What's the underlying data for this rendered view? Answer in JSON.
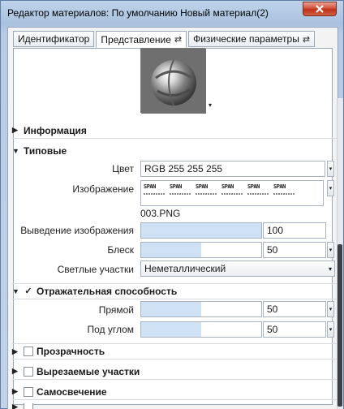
{
  "window": {
    "title": "Редактор материалов: По умолчанию Новый материал(2)"
  },
  "tabs": [
    {
      "label": "Идентификатор",
      "active": false,
      "pinned": false
    },
    {
      "label": "Представление",
      "active": true,
      "pinned": true
    },
    {
      "label": "Физические параметры",
      "active": false,
      "pinned": true
    }
  ],
  "icons": {
    "pin": "⇄",
    "expand": "▶",
    "collapse": "▼",
    "caret": "▾",
    "check": "✓"
  },
  "sections": {
    "info": {
      "label": "Информация",
      "expanded": false
    },
    "generic": {
      "label": "Типовые",
      "expanded": true
    },
    "reflectivity": {
      "label": "Отражательная способность",
      "expanded": true,
      "checked": true
    },
    "transparency": {
      "label": "Прозрачность",
      "expanded": false,
      "checked": false
    },
    "cutouts": {
      "label": "Вырезаемые участки",
      "expanded": false,
      "checked": false
    },
    "self_illumination": {
      "label": "Самосвечение",
      "expanded": false,
      "checked": false
    }
  },
  "generic": {
    "color_label": "Цвет",
    "color_value": "RGB 255 255 255",
    "image_label": "Изображение",
    "image_thumb_text": "SPAN",
    "image_thumb_count": 6,
    "image_name": "003.PNG",
    "image_fade_label": "Выведение изображения",
    "image_fade_value": "100",
    "image_fade_fraction": 1.0,
    "glossiness_label": "Блеск",
    "glossiness_value": "50",
    "glossiness_fraction": 0.5,
    "highlights_label": "Светлые участки",
    "highlights_value": "Неметаллический"
  },
  "reflectivity": {
    "direct_label": "Прямой",
    "direct_value": "50",
    "direct_fraction": 0.5,
    "oblique_label": "Под углом",
    "oblique_value": "50",
    "oblique_fraction": 0.5
  },
  "colors": {
    "slider_fill": "#cfe1f5",
    "close_button": "#c8452d"
  }
}
